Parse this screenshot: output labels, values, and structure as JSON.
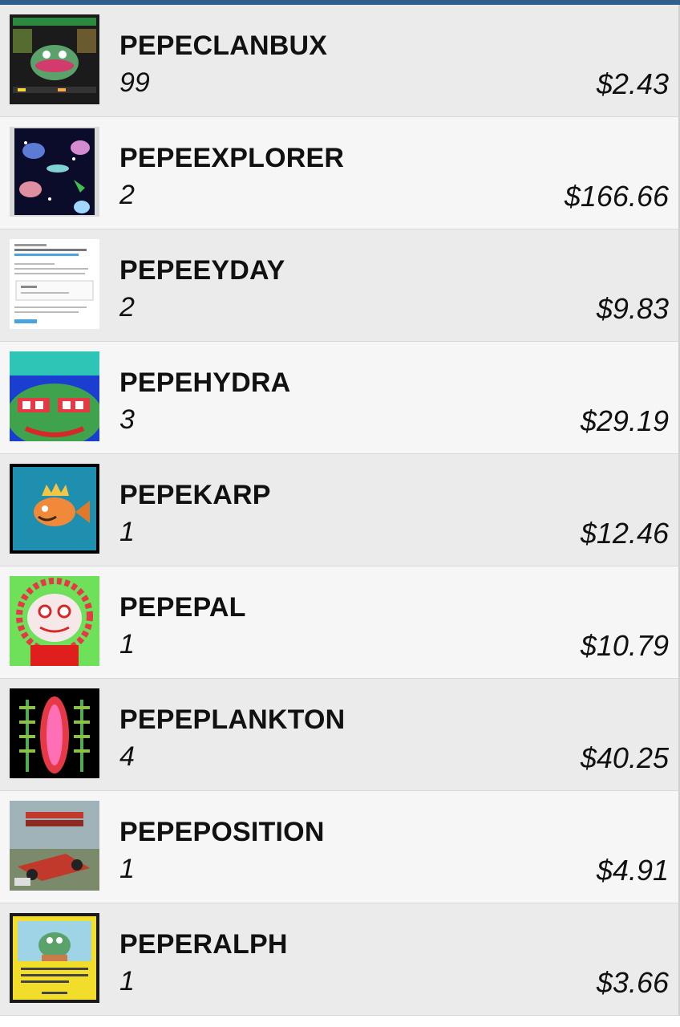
{
  "assets": [
    {
      "name": "PEPECLANBUX",
      "quantity": "99",
      "price": "$2.43",
      "icon": "pepeclanbux-card-image"
    },
    {
      "name": "PEPEEXPLORER",
      "quantity": "2",
      "price": "$166.66",
      "icon": "pepeexplorer-card-image"
    },
    {
      "name": "PEPEEYDAY",
      "quantity": "2",
      "price": "$9.83",
      "icon": "pepeeyday-card-image"
    },
    {
      "name": "PEPEHYDRA",
      "quantity": "3",
      "price": "$29.19",
      "icon": "pepehydra-card-image"
    },
    {
      "name": "PEPEKARP",
      "quantity": "1",
      "price": "$12.46",
      "icon": "pepekarp-card-image"
    },
    {
      "name": "PEPEPAL",
      "quantity": "1",
      "price": "$10.79",
      "icon": "pepepal-card-image"
    },
    {
      "name": "PEPEPLANKTON",
      "quantity": "4",
      "price": "$40.25",
      "icon": "pepeplankton-card-image"
    },
    {
      "name": "PEPEPOSITION",
      "quantity": "1",
      "price": "$4.91",
      "icon": "pepeposition-card-image"
    },
    {
      "name": "PEPERALPH",
      "quantity": "1",
      "price": "$3.66",
      "icon": "peperalph-card-image"
    }
  ],
  "colors": {
    "top_bar": "#2f5f8c",
    "row_shade_a": "#ebebeb",
    "row_shade_b": "#f6f6f6"
  }
}
